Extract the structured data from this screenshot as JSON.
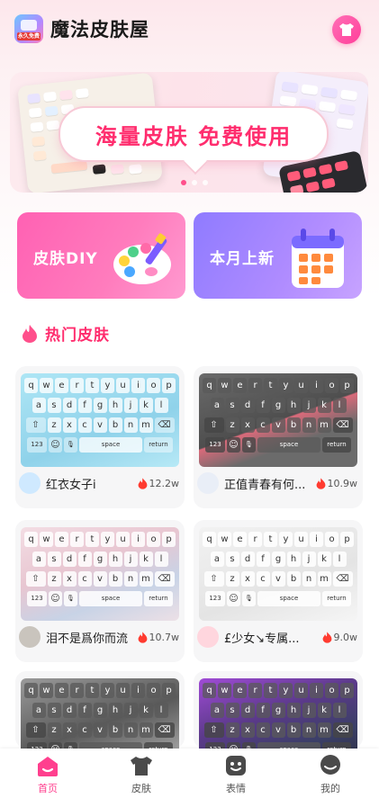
{
  "header": {
    "title": "魔法皮肤屋",
    "logo_text": "永久免费"
  },
  "banner": {
    "headline": "海量皮肤 免费使用",
    "slides": 3,
    "active_slide": 1
  },
  "feature_cards": [
    {
      "label": "皮肤DIY"
    },
    {
      "label": "本月上新"
    }
  ],
  "section": {
    "title": "热门皮肤"
  },
  "keyboard": {
    "row1": [
      "q",
      "w",
      "e",
      "r",
      "t",
      "y",
      "u",
      "i",
      "o",
      "p"
    ],
    "row2": [
      "a",
      "s",
      "d",
      "f",
      "g",
      "h",
      "j",
      "k",
      "l"
    ],
    "row3": [
      "z",
      "x",
      "c",
      "v",
      "b",
      "n",
      "m"
    ],
    "num_key": "123",
    "space_key": "space",
    "return_key": "return"
  },
  "skins": [
    {
      "author": "红衣女子i",
      "likes": "12.2w",
      "theme": "blue"
    },
    {
      "author": "正值青春有何...",
      "likes": "10.9w",
      "theme": "dark"
    },
    {
      "author": "泪不是爲你而流",
      "likes": "10.7w",
      "theme": "floral"
    },
    {
      "author": "£少女↘专属...",
      "likes": "9.0w",
      "theme": "light"
    },
    {
      "author": "",
      "likes": "",
      "theme": "anime"
    },
    {
      "author": "",
      "likes": "",
      "theme": "purple"
    }
  ],
  "tabbar": [
    {
      "label": "首页",
      "active": true
    },
    {
      "label": "皮肤",
      "active": false
    },
    {
      "label": "表情",
      "active": false
    },
    {
      "label": "我的",
      "active": false
    }
  ],
  "colors": {
    "accent": "#ff3f8e",
    "diy_card": "#ff61b3",
    "new_card": "#8f7bff"
  }
}
